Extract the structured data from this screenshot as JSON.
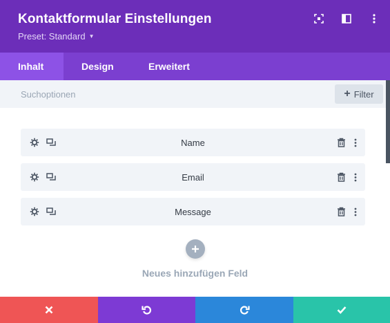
{
  "header": {
    "title": "Kontaktformular Einstellungen",
    "preset_label": "Preset: Standard",
    "icons": [
      "expand-icon",
      "split-view-icon",
      "more-vertical-icon"
    ]
  },
  "tabs": [
    {
      "label": "Inhalt",
      "active": true
    },
    {
      "label": "Design",
      "active": false
    },
    {
      "label": "Erweitert",
      "active": false
    }
  ],
  "search": {
    "placeholder": "Suchoptionen",
    "filter_label": "Filter"
  },
  "fields": [
    {
      "label": "Name"
    },
    {
      "label": "Email"
    },
    {
      "label": "Message"
    }
  ],
  "add_field": {
    "label": "Neues hinzufügen Feld"
  },
  "footer": {
    "buttons": [
      "close-icon",
      "undo-icon",
      "redo-icon",
      "check-icon"
    ]
  },
  "colors": {
    "header_bg": "#6c2eb9",
    "tabs_bg": "#7b3fd0",
    "tab_active_bg": "#8d52e6",
    "cancel": "#ef5555",
    "undo": "#7d3ad4",
    "redo": "#2b87da",
    "save": "#29c4a9"
  }
}
